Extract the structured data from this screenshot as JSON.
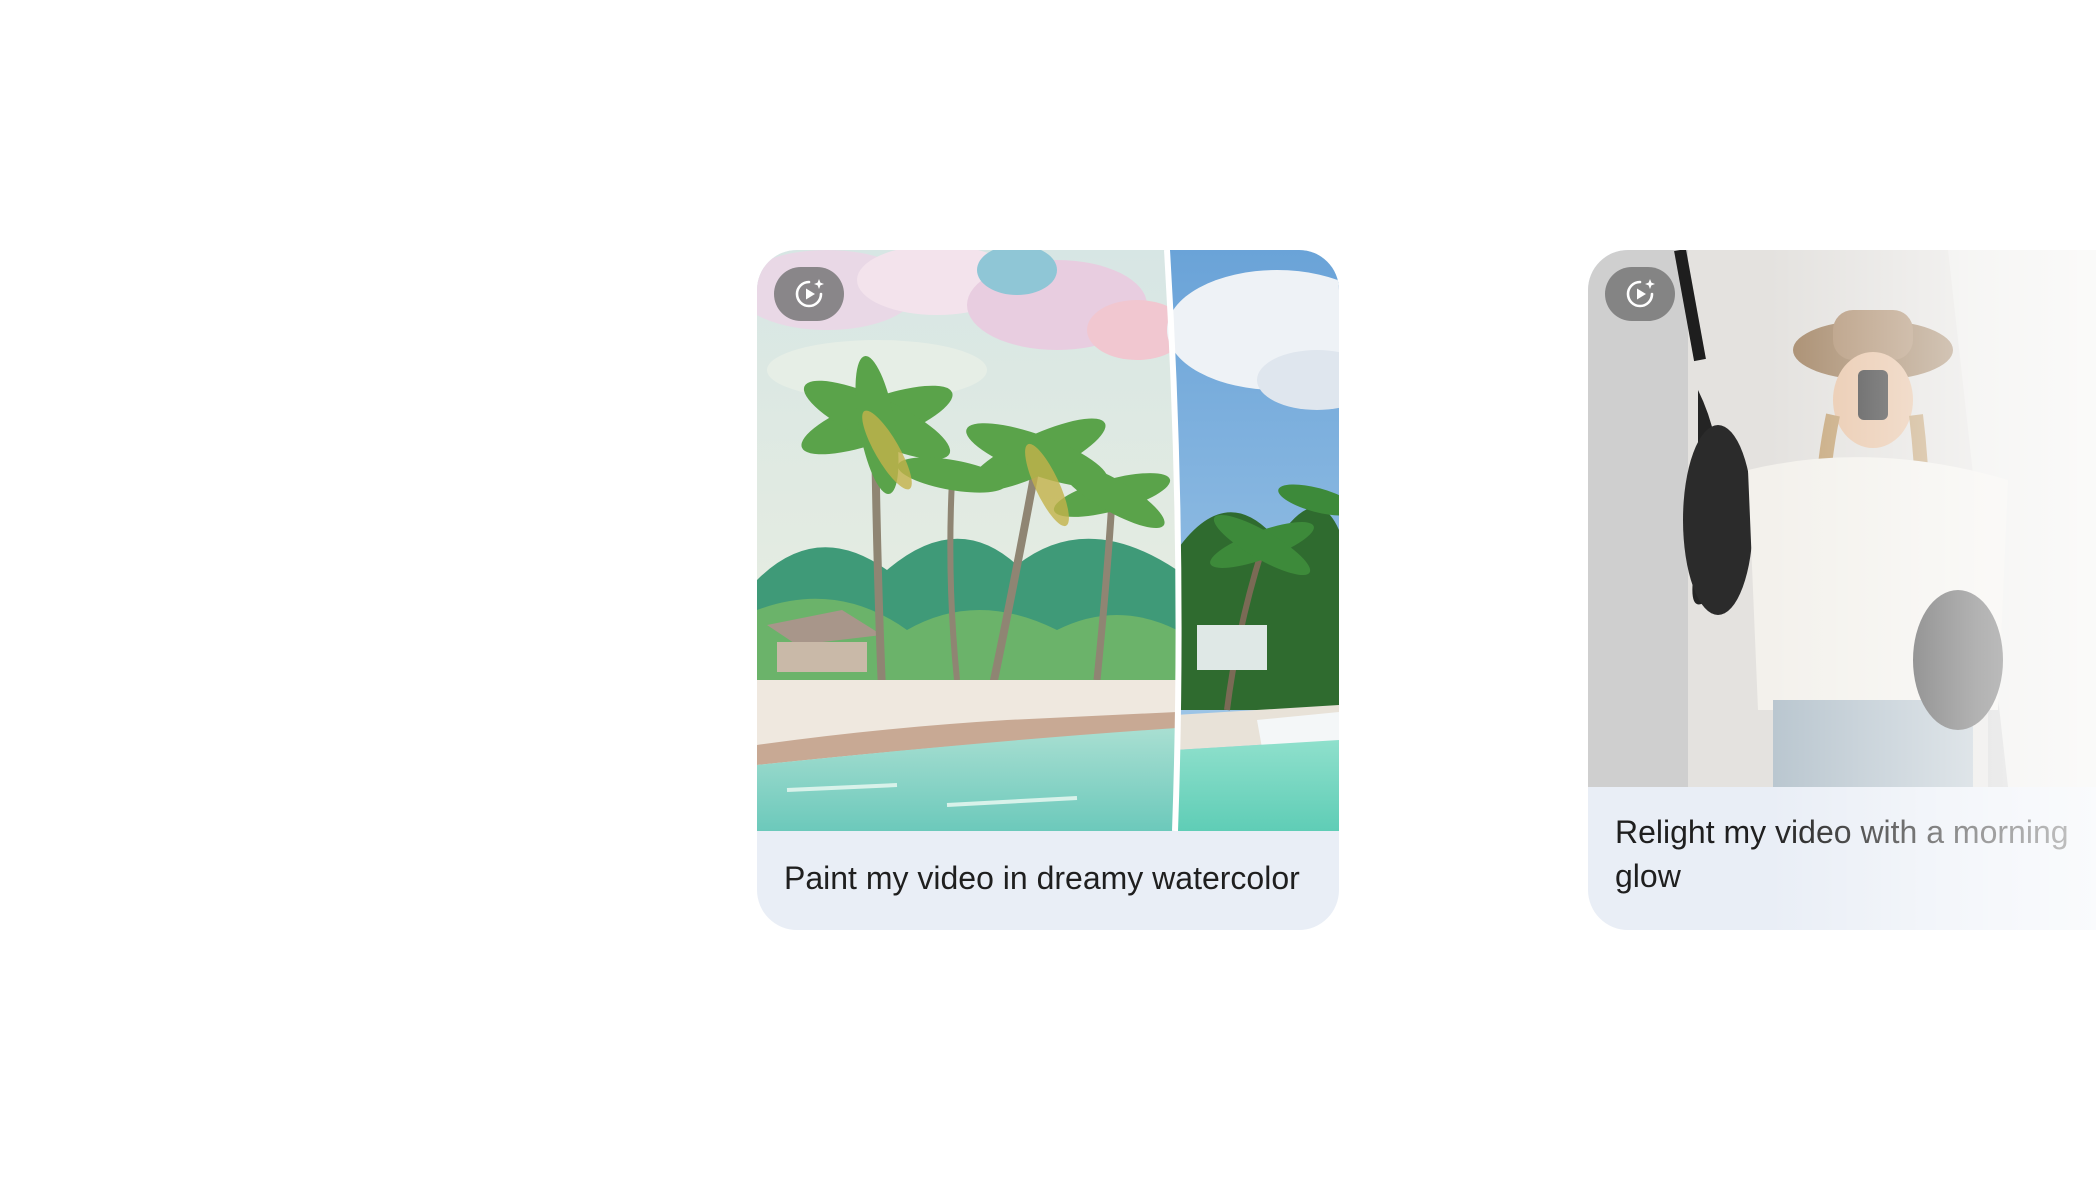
{
  "cards": [
    {
      "caption": "Paint my video in dreamy watercolor",
      "badge_icon": "video-sparkle-icon",
      "image": "watercolor-beach-split"
    },
    {
      "caption": "Relight my video with a morning glow",
      "badge_icon": "video-sparkle-icon",
      "image": "mirror-selfie-blurred"
    }
  ],
  "colors": {
    "card_background": "#e9eef6",
    "caption_text": "#1f1f1f",
    "badge_background": "#6e6e6e"
  }
}
